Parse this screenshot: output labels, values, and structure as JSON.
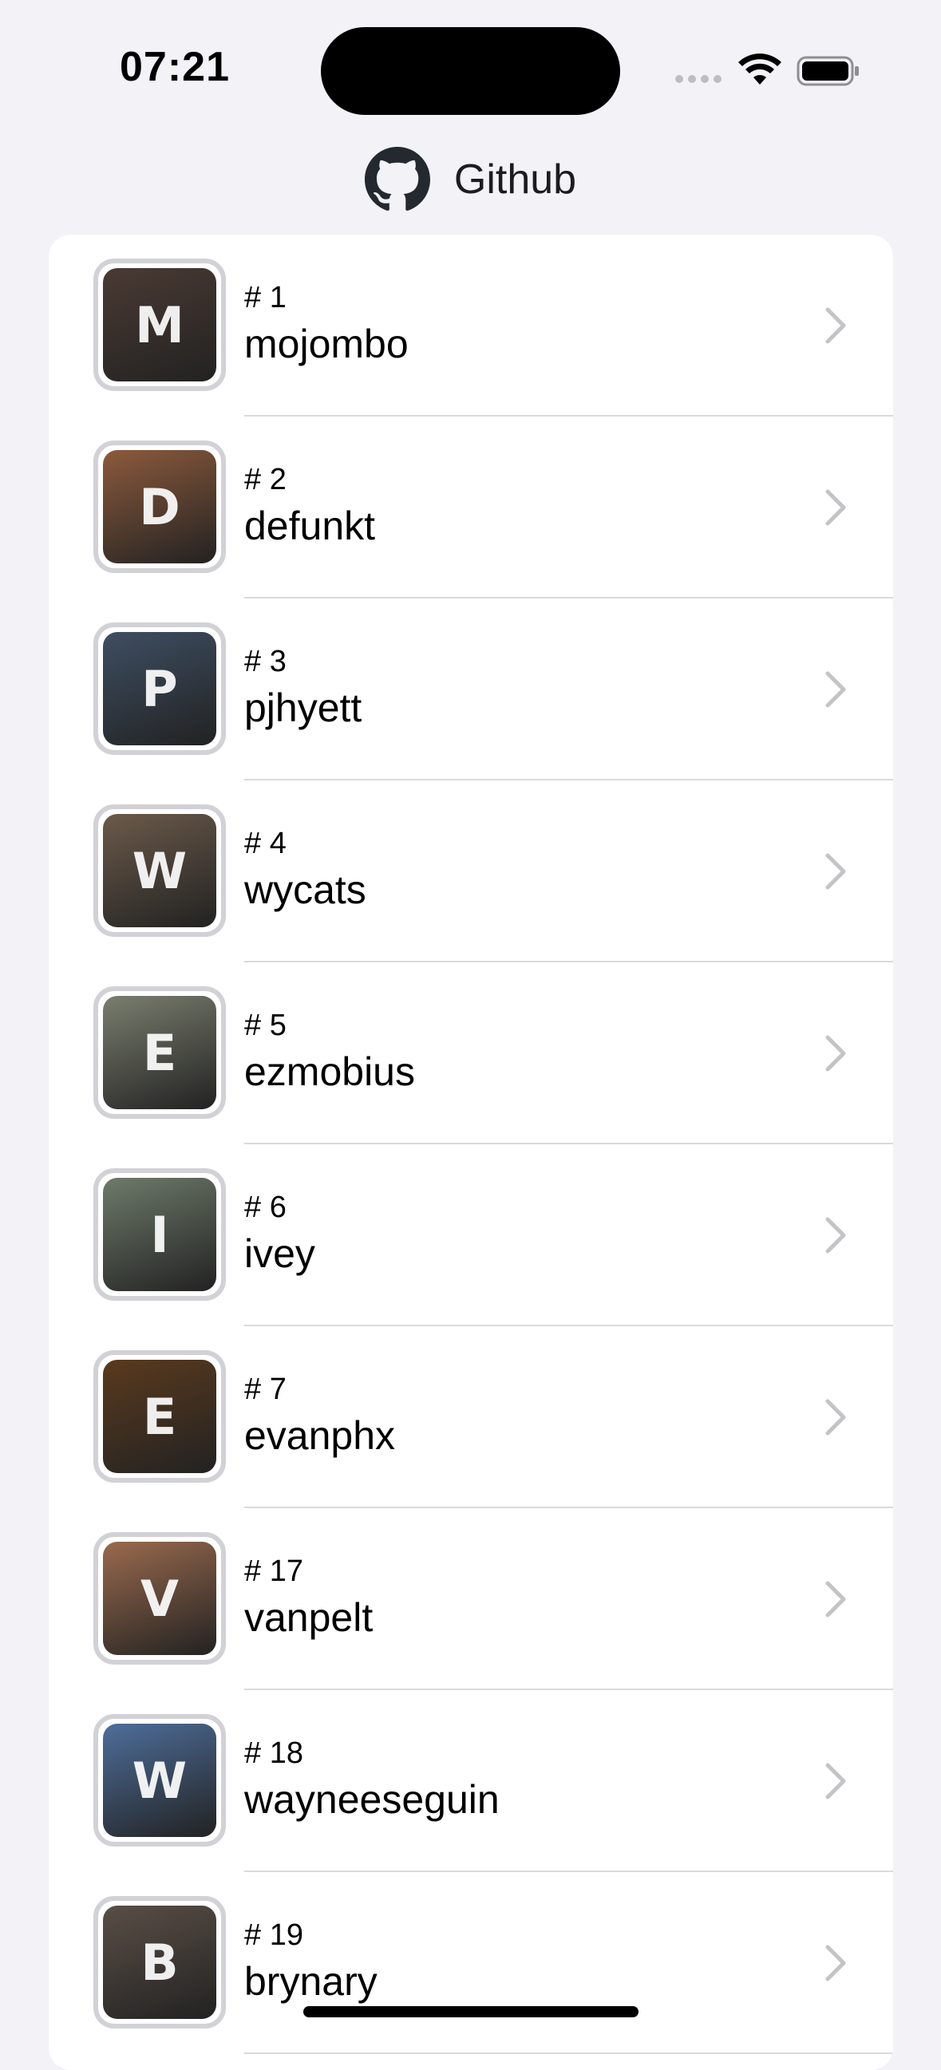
{
  "status_bar": {
    "time": "07:21"
  },
  "header": {
    "title": "Github",
    "logo_icon": "github-octocat-icon"
  },
  "users": [
    {
      "rank": "# 1",
      "login": "mojombo",
      "initial": "M",
      "color": "#4A3A33"
    },
    {
      "rank": "# 2",
      "login": "defunkt",
      "initial": "D",
      "color": "#8C5A3C"
    },
    {
      "rank": "# 3",
      "login": "pjhyett",
      "initial": "P",
      "color": "#3E4E62"
    },
    {
      "rank": "# 4",
      "login": "wycats",
      "initial": "W",
      "color": "#6B5A4A"
    },
    {
      "rank": "# 5",
      "login": "ezmobius",
      "initial": "E",
      "color": "#7A7E6E"
    },
    {
      "rank": "# 6",
      "login": "ivey",
      "initial": "I",
      "color": "#6E7A6A"
    },
    {
      "rank": "# 7",
      "login": "evanphx",
      "initial": "E",
      "color": "#5A3A1E"
    },
    {
      "rank": "# 17",
      "login": "vanpelt",
      "initial": "V",
      "color": "#9A6A4E"
    },
    {
      "rank": "# 18",
      "login": "wayneeseguin",
      "initial": "W",
      "color": "#4E6E9A"
    },
    {
      "rank": "# 19",
      "login": "brynary",
      "initial": "B",
      "color": "#5A4E46"
    }
  ],
  "colors": {
    "background": "#F2F2F7",
    "card": "#FFFFFF",
    "separator": "#DADADE",
    "chevron": "#C4C4C7"
  }
}
